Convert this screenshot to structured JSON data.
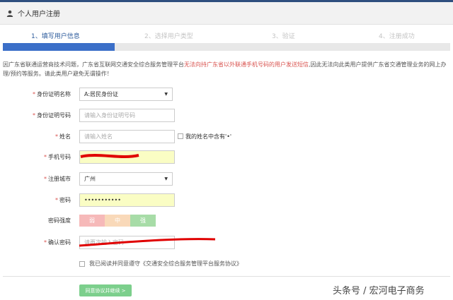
{
  "header": {
    "title": "个人用户注册"
  },
  "steps": [
    {
      "label": "1、填写用户信息"
    },
    {
      "label": "2、选择用户类型"
    },
    {
      "label": "3、验证"
    },
    {
      "label": "4、注册成功"
    }
  ],
  "progress": {
    "fraction": 0.25
  },
  "notice": {
    "part1": "因广东省联通运营商技术问题，广东省互联网交通安全综合服务管理平台",
    "warn": "无法向持广东省以外联通手机号码的用户发送短信",
    "part2": ",因此无法向此类用户提供广东省交通管理业务的网上办理/预约等服务。请此类用户避免无谓操作！"
  },
  "form": {
    "id_type": {
      "label": "身份证明名称",
      "value": "A:居民身份证"
    },
    "id_number": {
      "label": "身份证明号码",
      "placeholder": "请输入身份证明号码"
    },
    "name": {
      "label": "姓名",
      "placeholder": "请输入姓名",
      "extra_checkbox_label": "我的姓名中含有'•'"
    },
    "phone": {
      "label": "手机号码"
    },
    "city": {
      "label": "注册城市",
      "value": "广州"
    },
    "password": {
      "label": "密码",
      "value": "•••••••••••"
    },
    "strength": {
      "label": "密码强度",
      "levels": [
        "弱",
        "中",
        "强"
      ]
    },
    "confirm_password": {
      "label": "确认密码",
      "placeholder": "请再次输入密码"
    },
    "agree": {
      "text": "我已阅读并同意遵守《交通安全综合服务管理平台服务协议》"
    },
    "submit": {
      "label": "同意协议并继续 >"
    }
  },
  "watermark": "头条号 / 宏河电子商务",
  "colors": {
    "accent": "#3b6fc8",
    "warn": "#d9534f",
    "weak": "#f6b9b9",
    "medium": "#f9d9b9",
    "strong": "#a7dca7",
    "submit": "#7ccf8c",
    "autofill": "#fafdc4",
    "scribble": "#e00000"
  }
}
